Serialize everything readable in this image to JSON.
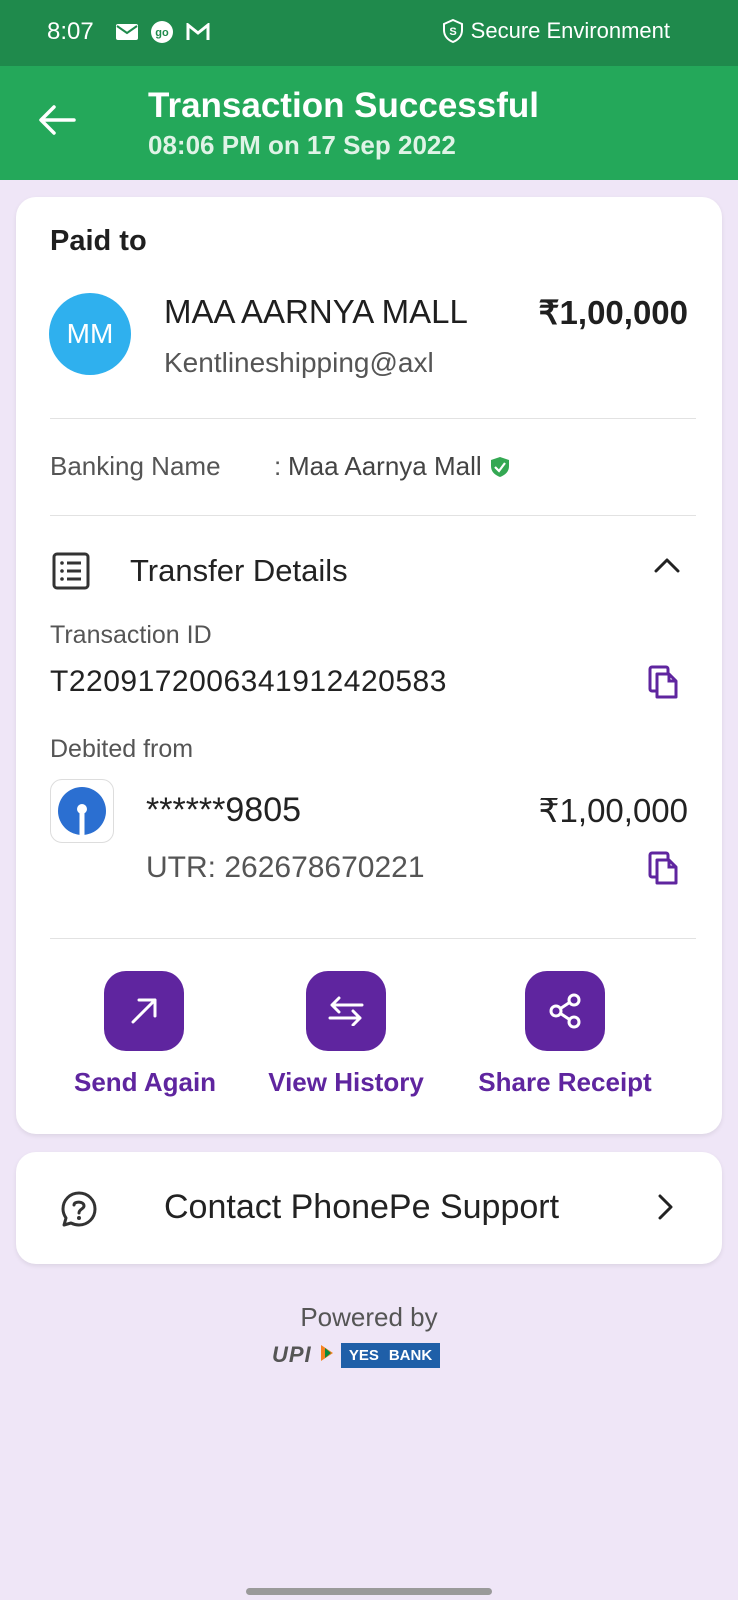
{
  "status_bar": {
    "time": "8:07",
    "secure_label": "Secure Environment"
  },
  "app_bar": {
    "title": "Transaction Successful",
    "subtitle": "08:06 PM on 17 Sep 2022"
  },
  "payment": {
    "paid_to_label": "Paid to",
    "avatar_initials": "MM",
    "payee_name": "MAA AARNYA MALL",
    "amount": "₹1,00,000",
    "vpa": "Kentlineshipping@axl",
    "banking_name_label": "Banking Name",
    "banking_name_separator": ":",
    "banking_name_value": "Maa Aarnya Mall"
  },
  "transfer_details": {
    "title": "Transfer Details",
    "transaction_id_label": "Transaction ID",
    "transaction_id": "T2209172006341912420583",
    "debited_from_label": "Debited from",
    "account": "******9805",
    "debit_amount": "₹1,00,000",
    "utr": "UTR: 262678670221"
  },
  "actions": [
    {
      "label": "Send Again",
      "icon": "arrow-up-right-icon"
    },
    {
      "label": "View History",
      "icon": "swap-arrows-icon"
    },
    {
      "label": "Share Receipt",
      "icon": "share-icon"
    }
  ],
  "support": {
    "label": "Contact PhonePe Support"
  },
  "footer": {
    "powered_by": "Powered by",
    "upi_logo_text": "UPI",
    "bank_logo_text_1": "YES",
    "bank_logo_text_2": "BANK"
  },
  "colors": {
    "status_bar": "#1f8a4c",
    "app_bar": "#24a85a",
    "accent_purple": "#5f259f",
    "background": "#efe6f7",
    "avatar": "#2fb0ee"
  }
}
